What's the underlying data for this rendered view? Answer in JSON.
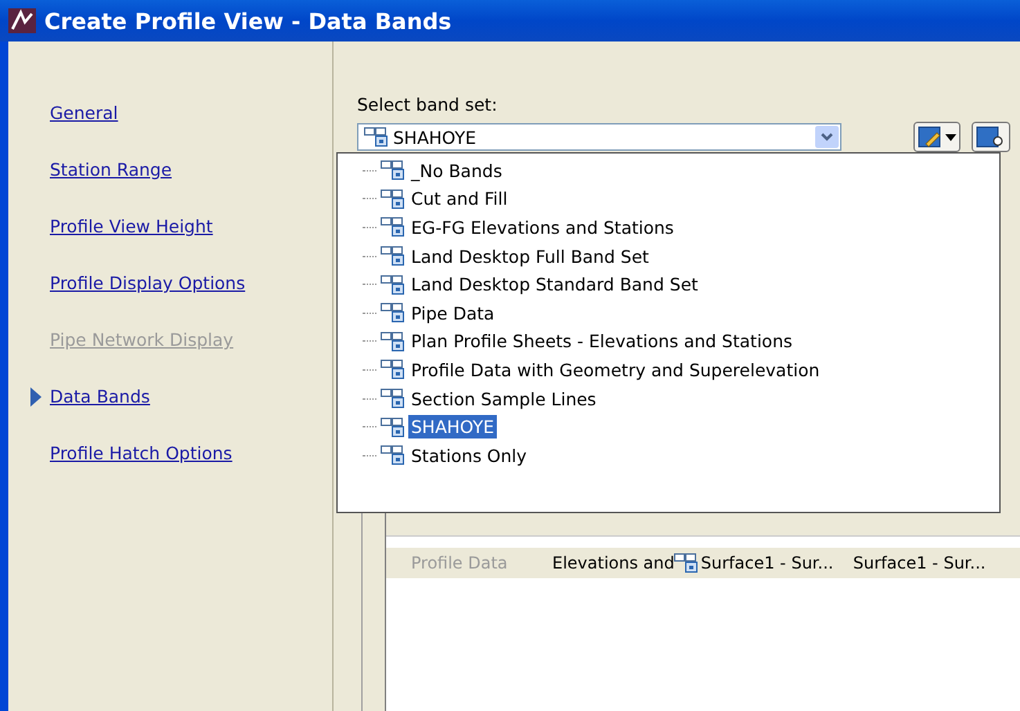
{
  "window": {
    "title": "Create Profile View - Data Bands"
  },
  "sidebar": {
    "items": [
      {
        "label": "General",
        "selected": false,
        "disabled": false
      },
      {
        "label": "Station Range",
        "selected": false,
        "disabled": false
      },
      {
        "label": "Profile View Height",
        "selected": false,
        "disabled": false
      },
      {
        "label": "Profile Display Options",
        "selected": false,
        "disabled": false
      },
      {
        "label": "Pipe Network Display",
        "selected": false,
        "disabled": true
      },
      {
        "label": "Data Bands",
        "selected": true,
        "disabled": false
      },
      {
        "label": "Profile Hatch Options",
        "selected": false,
        "disabled": false
      }
    ]
  },
  "band_set": {
    "label": "Select band set:",
    "value": "SHAHOYE",
    "expanded": true,
    "options": [
      {
        "label": "_No Bands",
        "selected": false
      },
      {
        "label": "Cut and Fill",
        "selected": false
      },
      {
        "label": "EG-FG Elevations and Stations",
        "selected": false
      },
      {
        "label": "Land Desktop Full Band Set",
        "selected": false
      },
      {
        "label": "Land Desktop Standard Band Set",
        "selected": false
      },
      {
        "label": "Pipe Data",
        "selected": false
      },
      {
        "label": "Plan Profile Sheets - Elevations and Stations",
        "selected": false
      },
      {
        "label": "Profile Data with Geometry and Superelevation",
        "selected": false
      },
      {
        "label": "Section Sample Lines",
        "selected": false
      },
      {
        "label": "SHAHOYE",
        "selected": true
      },
      {
        "label": "Stations Only",
        "selected": false
      }
    ]
  },
  "table": {
    "rows": [
      {
        "band_type": "Profile Data",
        "band_type_disabled": true,
        "style": "Elevations and",
        "profile1": "Surface1 - Sur...",
        "profile2": "Surface1 - Sur..."
      }
    ]
  }
}
